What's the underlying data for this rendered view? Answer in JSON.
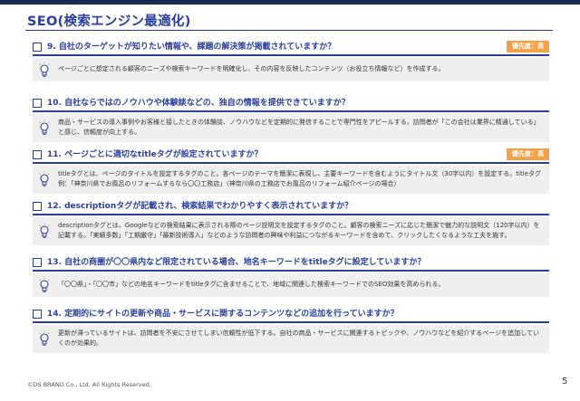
{
  "title": "SEO(検索エンジン最適化)",
  "items": [
    {
      "question": "9. 自社のターゲットが知りたい情報や、課題の解決策が掲載されていますか？",
      "badge": "優先度：高",
      "note": "ページごとに想定される顧客のニーズや検索キーワードを明確化し、その内容を反映したコンテンツ（お役立ち情報など）を作成する。"
    },
    {
      "question": "10. 自社ならではのノウハウや体験談などの、独自の情報を提供できていますか？",
      "badge": "",
      "note": "商品・サービスの導入事例やお客様と接したときの体験談、ノウハウなどを定期的に発信することで専門性をアピールする。訪問者が「この会社は業界に精通している」と感じ、信頼度が向上する。"
    },
    {
      "question": "11. ページごとに適切なtitleタグが設定されていますか？",
      "badge": "優先度：高",
      "note": "titleタグとは、ページのタイトルを設定するタグのこと。各ページのテーマを簡潔に表現し、主要キーワードを含むようにタイトル文（30字以内）を設定する。titleタグ例：「神奈川県でお風呂のリフォームするなら〇〇工務店」（神奈川県の工務店でお風呂のリフォーム紹介ページの場合）"
    },
    {
      "question": "12. descriptionタグが記載され、検索結果でわかりやすく表示されていますか？",
      "badge": "",
      "note": "descriptionタグとは、Googleなどの検索結果に表示される際のページ説明文を設定するタグのこと。顧客の検索ニーズに応じた簡潔で魅力的な説明文（120字以内）を記載する。「実績多数」「工期厳守」「最新技術導入」などのような訪問者の興味や利益につながるキーワードを含めて、クリックしたくなるような工夫を施す。"
    },
    {
      "question": "13. 自社の商圏が〇〇県内など限定されている場合、地名キーワードをtitleタグに設定していますか？",
      "badge": "",
      "note": "「〇〇県」・「〇〇市」などの地名キーワードをtitleタグに含ませることで、地域に関連した検索キーワードでのSEO効果を高められる。"
    },
    {
      "question": "14. 定期的にサイトの更新や商品・サービスに関するコンテンツなどの追加を行っていますか？",
      "badge": "",
      "note": "更新が滞っているサイトは、訪問者を不安にさせてしまい信頼性が低下する。自社の商品・サービスに関連するトピックや、ノウハウなどを紹介するページを追加していくのが効果的。"
    }
  ],
  "footer": {
    "copyright": "©DS BRAND Co., Ltd. All Rights Reserved.",
    "page": "5"
  },
  "colors": {
    "accent": "#2a3f9d",
    "badge": "#f4a24a",
    "note_bg": "#efefef",
    "topbar": "#1b2a55"
  },
  "icons": {
    "note": "lightbulb-icon"
  }
}
